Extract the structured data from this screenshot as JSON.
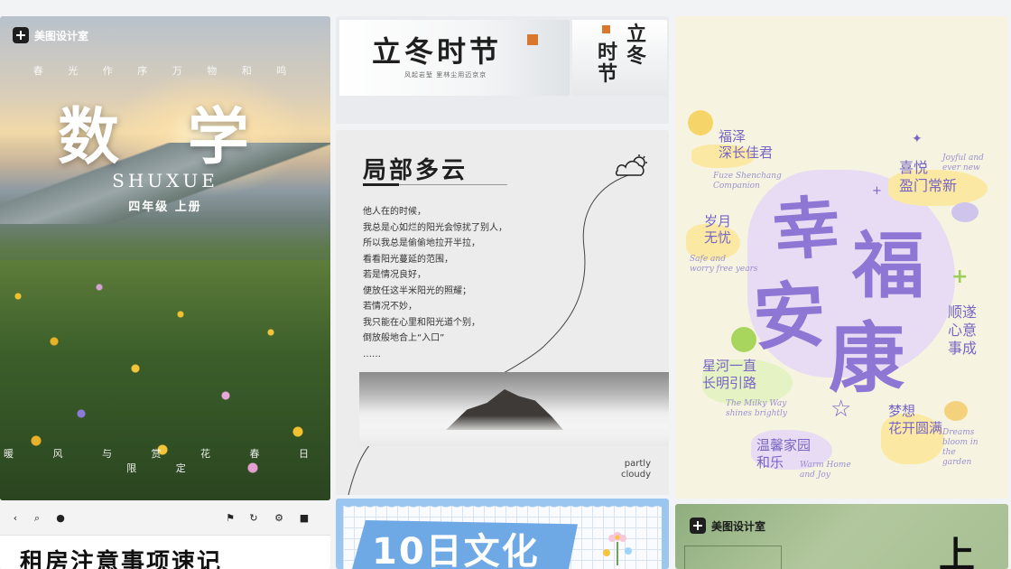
{
  "math_card": {
    "brand": "美图设计室",
    "subtitle": "春 光 作 序 万 物 和 鸣",
    "title": "数 学",
    "pinyin": "SHUXUE",
    "grade": "四年级 上册",
    "footer": "暖 风 与 赏 花 春 日 限 定"
  },
  "lidong_card": {
    "title": "立冬时节",
    "tagline": "风起岩堑 里林尘用迈京京",
    "vertical_left": [
      "时",
      "节"
    ],
    "vertical_right": [
      "立",
      "冬"
    ]
  },
  "cloud_card": {
    "title": "局部多云",
    "poem": [
      "他人在的时候，",
      "我总是心如烂的阳光会惊扰了别人，",
      "所以我总是偷偷地拉开半拉，",
      "看看阳光蔓延的范围，",
      "若是情况良好，",
      "便放任这半米阳光的照耀；",
      "若情况不妙，",
      "我只能在心里和阳光道个别，",
      "倒放般地合上“入口”",
      "……"
    ],
    "footer_line1": "partly",
    "footer_line2": "cloudy"
  },
  "blessing_card": {
    "big_chars": [
      "幸",
      "福",
      "安",
      "康"
    ],
    "phrases": [
      {
        "cn": "福泽\n深长佳君",
        "en": "Fuze Shenchang\nCompanion"
      },
      {
        "cn": "喜悦\n盈门常新",
        "en": "Joyful and\never new"
      },
      {
        "cn": "岁月\n无忧",
        "en": "Safe and\nworry free years"
      },
      {
        "cn": "顺遂\n心意\n事成",
        "en": ""
      },
      {
        "cn": "星河一直\n长明引路",
        "en": "The Milky Way\nshines brightly"
      },
      {
        "cn": "梦想\n花开圆满",
        "en": "Dreams\nbloom in\nthe\ngarden"
      },
      {
        "cn": "温馨家园\n和乐",
        "en": "Warm Home\nand Joy"
      }
    ]
  },
  "browser_card": {
    "title": "租房注意事项速记",
    "toolbar": [
      "back-icon",
      "search-icon",
      "bell-icon",
      "flag-icon",
      "refresh-icon",
      "settings-icon",
      "lock-icon"
    ]
  },
  "culture_card": {
    "title": "10日文化"
  },
  "green_card": {
    "brand": "美图设计室",
    "title": "上"
  },
  "colors": {
    "purple": "#8e77d4",
    "orange_seal": "#d9772c",
    "sky_blue": "#9bc6ef"
  }
}
